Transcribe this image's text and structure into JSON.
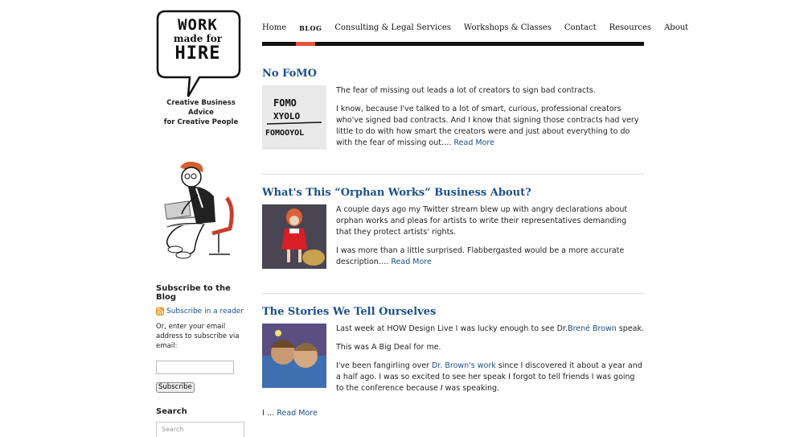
{
  "logo": {
    "line1": "WORK",
    "line2": "made for",
    "line3": "HIRE"
  },
  "tagline": {
    "line1": "Creative Business Advice",
    "line2": "for Creative People"
  },
  "sidebar": {
    "subscribe_heading": "Subscribe to the Blog",
    "rss_link": "Subscribe in a reader",
    "email_text": "Or, enter your email address to subscribe via email:",
    "subscribe_button": "Subscribe",
    "search_heading": "Search",
    "search_placeholder": "Search"
  },
  "nav": {
    "items": [
      "Home",
      "BLOG",
      "Consulting & Legal Services",
      "Workshops & Classes",
      "Contact",
      "Resources",
      "About"
    ]
  },
  "posts": [
    {
      "title": "No FoMO",
      "thumb_text": [
        "FOMO",
        "XYOLO",
        "FOMOOYOL"
      ],
      "p1": "The fear of missing out leads a lot of creators to sign bad contracts.",
      "p2": "I know, because I've talked to a lot of smart, curious, professional creators who've signed bad contracts. And I know that signing those contracts had very little to do with how smart the creators were and just about everything to do with the fear of missing out…. ",
      "read_more": "Read More"
    },
    {
      "title": "What's This “Orphan Works” Business About?",
      "p1": "A couple days ago my Twitter stream blew up with angry declarations about orphan works and pleas for artists to write their representatives demanding that they protect artists' rights.",
      "p2": "I was more than a little surprised. Flabbergasted would be a more accurate description…. ",
      "read_more": "Read More"
    },
    {
      "title": "The Stories We Tell Ourselves",
      "p1_before": "Last week at HOW Design Live I was lucky enough to see Dr.",
      "p1_link": "Brené Brown",
      "p1_after": " speak.",
      "p2": "This was A Big Deal for me.",
      "p3_before": "I've been fangirling over ",
      "p3_link": "Dr. Brown's work",
      "p3_after": " since I discovered it about a year and a half ago. I was so excited to see her speak I forgot to tell friends I was going to the conference because ",
      "p3_italic": "I",
      "p3_end": " was speaking.",
      "tail_before": "I … ",
      "read_more": "Read More"
    }
  ],
  "colors": {
    "link": "#1b4f8a",
    "nav_active": "#e0533c",
    "rss": "#f7931e"
  }
}
